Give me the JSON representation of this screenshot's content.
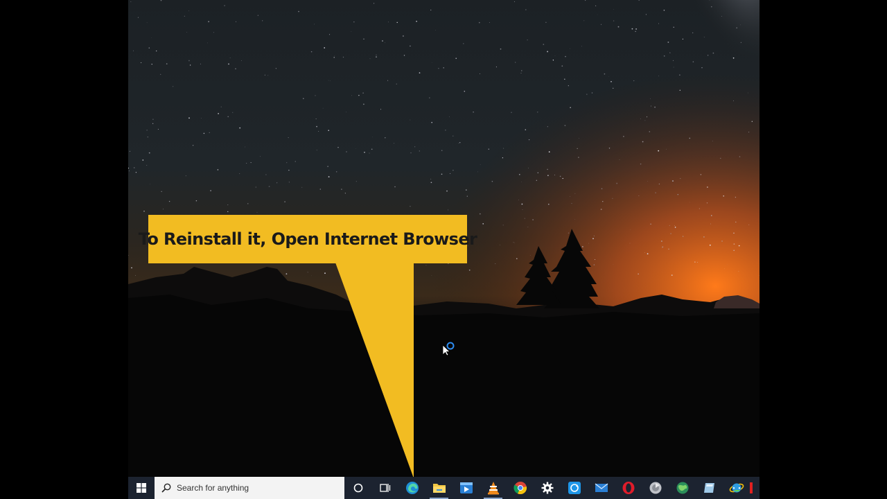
{
  "callout": {
    "text": "To Reinstall it, Open Internet Browser",
    "color": "#f2bc22"
  },
  "taskbar": {
    "search_placeholder": "Search for anything",
    "icons": [
      "windows-start-icon",
      "search-magnifier-icon",
      "cortana-circle-icon",
      "task-view-icon",
      "edge-browser-icon",
      "file-explorer-icon",
      "media-player-icon",
      "vlc-cone-icon",
      "chrome-icon",
      "settings-gear-icon",
      "sync-app-icon",
      "mail-icon",
      "opera-icon",
      "gray-disc-app-icon",
      "globe-app-icon",
      "notepad-app-icon",
      "internet-explorer-icon"
    ]
  }
}
